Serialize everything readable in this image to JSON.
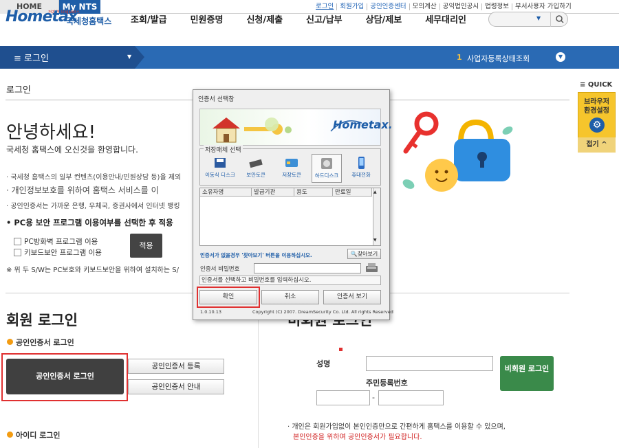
{
  "topbar": {
    "home": "HOME",
    "mynts": "My NTS",
    "links": [
      "로그인",
      "회원가입",
      "공인인증센터",
      "모의계산",
      "공익법인공시",
      "법령정보",
      "부서사용자 가입하기"
    ]
  },
  "header": {
    "logo_sub": "전자연 납세서비스",
    "logo_word": "Hometax",
    "logo_kr": "국세청홈택스",
    "nav": [
      "조회/발급",
      "민원증명",
      "신청/제출",
      "신고/납부",
      "상담/제보",
      "세무대리인"
    ]
  },
  "bluebar": {
    "crumb": "≡  로그인",
    "biz_num": "1",
    "biz_label": "사업자등록상태조회"
  },
  "page": {
    "title": "로그인",
    "hello": "안녕하세요!",
    "welcome": "국세청 홈택스에 오신것을 환영합니다.",
    "notice1": "· 국세청 홈택스의 일부 컨텐츠(이용안내/민원상담 등)을 제외",
    "notice2": "· 개인정보보호를 위하여 홈택스 서비스를 이",
    "notice3": "· 공인인증서는 가까운 은행, 우체국, 증권사에서 인터넷 뱅킹",
    "pc_question": "• PC용 보안 프로그램 이용여부를 선택한 후 적용",
    "chk1": "PC방화벽 프로그램 이용",
    "chk2": "키보드보안 프로그램 이용",
    "apply": "적용",
    "sw_note": "※ 위 두 S/W는 PC보호와 키보드보안을 위하여 설치하는 S/"
  },
  "member": {
    "title": "회원 로그인",
    "cert_login_title": "공인인증서 로그인",
    "cert_login_btn": "공인인증서 로그인",
    "cert_register_btn": "공인인증서 등록",
    "cert_guide_btn": "공인인증서 안내",
    "id_login_title": "아이디 로그인"
  },
  "nonmember": {
    "title": "비회원 로그인",
    "name_label": "성명",
    "rrn_label": "주민등록번호",
    "rrn_dash": "-",
    "btn": "비회원 로그인",
    "desc": "· 개인은 회원가입없이 본인인증만으로 간편하게 홈택스를 이용할 수 있으며,",
    "warn": "본인인증을 위하여 공인인증서가 필요합니다."
  },
  "quick": {
    "label": "≡ QUICK",
    "text": "브라우저 환경설정",
    "fold": "접기 ^"
  },
  "popup": {
    "title": "인증서 선택창",
    "banner_logo": "Hometax.",
    "storage_label": "저장매체 선택",
    "media": [
      "이동식 디스크",
      "보안토큰",
      "저장토큰",
      "하드디스크",
      "휴대전화"
    ],
    "columns": [
      "소유자명",
      "발급기관",
      "용도",
      "만료일"
    ],
    "no_cert_note": "인증서가 없을경우 '찾아보기' 버튼을 이용하십시오.",
    "find": "찾아보기",
    "pw_label": "인증서 비밀번호",
    "status": "인증서를 선택하고 비밀번호를 입력하십시오.",
    "ok": "확인",
    "cancel": "취소",
    "view": "인증서 보기",
    "version": "1.0.10.13",
    "copyright": "Copyright (C) 2007. DreamSecurity Co. Ltd. All rights Reserved"
  },
  "colors": {
    "brand_blue": "#1f5ea8",
    "highlight_red": "#e03030",
    "nonmember_green": "#3a8a4a",
    "quick_yellow": "#f6c52c"
  }
}
